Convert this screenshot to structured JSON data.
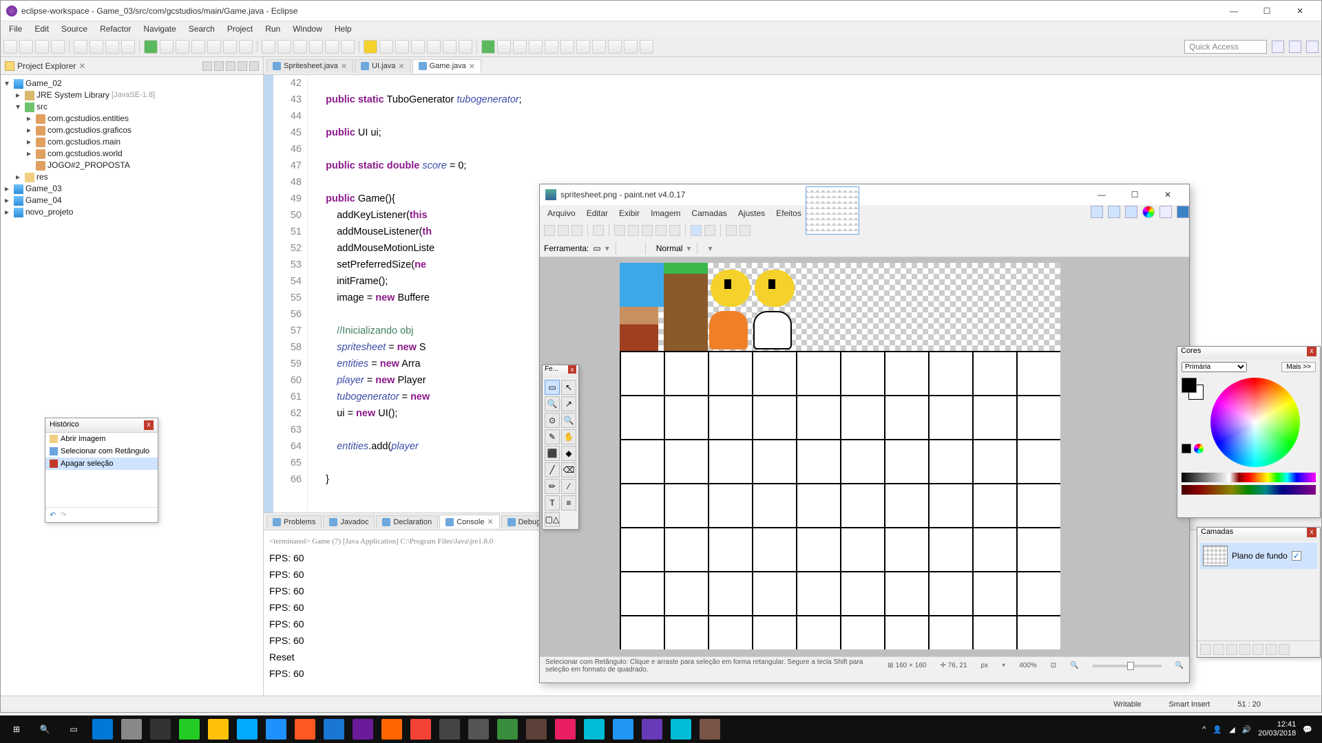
{
  "eclipse": {
    "title": "eclipse-workspace - Game_03/src/com/gcstudios/main/Game.java - Eclipse",
    "menus": [
      "File",
      "Edit",
      "Source",
      "Refactor",
      "Navigate",
      "Search",
      "Project",
      "Run",
      "Window",
      "Help"
    ],
    "quick_access": "Quick Access",
    "project_explorer": {
      "title": "Project Explorer",
      "tree": [
        {
          "indent": 0,
          "arrow": "▾",
          "icon": "proj",
          "label": "Game_02"
        },
        {
          "indent": 1,
          "arrow": "▸",
          "icon": "lib",
          "label": "JRE System Library",
          "note": "[JavaSE-1.8]"
        },
        {
          "indent": 1,
          "arrow": "▾",
          "icon": "src",
          "label": "src"
        },
        {
          "indent": 2,
          "arrow": "▸",
          "icon": "pkg",
          "label": "com.gcstudios.entities"
        },
        {
          "indent": 2,
          "arrow": "▸",
          "icon": "pkg",
          "label": "com.gcstudios.graficos"
        },
        {
          "indent": 2,
          "arrow": "▸",
          "icon": "pkg",
          "label": "com.gcstudios.main"
        },
        {
          "indent": 2,
          "arrow": "▸",
          "icon": "pkg",
          "label": "com.gcstudios.world"
        },
        {
          "indent": 2,
          "arrow": "",
          "icon": "pkg",
          "label": "JOGO#2_PROPOSTA"
        },
        {
          "indent": 1,
          "arrow": "▸",
          "icon": "fold",
          "label": "res"
        },
        {
          "indent": 0,
          "arrow": "▸",
          "icon": "proj",
          "label": "Game_03"
        },
        {
          "indent": 0,
          "arrow": "▸",
          "icon": "proj",
          "label": "Game_04"
        },
        {
          "indent": 0,
          "arrow": "▸",
          "icon": "proj",
          "label": "novo_projeto"
        }
      ]
    },
    "tabs": [
      {
        "label": "Spritesheet.java",
        "active": false
      },
      {
        "label": "UI.java",
        "active": false
      },
      {
        "label": "Game.java",
        "active": true
      }
    ],
    "code_lines": [
      {
        "n": 42,
        "html": ""
      },
      {
        "n": 43,
        "html": "    <span class='kw'>public</span> <span class='kw'>static</span> TuboGenerator <span class='fld'>tubogenerator</span>;"
      },
      {
        "n": 44,
        "html": ""
      },
      {
        "n": 45,
        "html": "    <span class='kw'>public</span> UI ui;"
      },
      {
        "n": 46,
        "html": ""
      },
      {
        "n": 47,
        "html": "    <span class='kw'>public</span> <span class='kw'>static</span> <span class='kw'>double</span> <span class='fld'>score</span> = 0;"
      },
      {
        "n": 48,
        "html": ""
      },
      {
        "n": 49,
        "html": "    <span class='kw'>public</span> Game(){"
      },
      {
        "n": 50,
        "html": "        addKeyListener(<span class='kw'>this</span>"
      },
      {
        "n": 51,
        "html": "        addMouseListener(<span class='kw'>th</span>"
      },
      {
        "n": 52,
        "html": "        addMouseMotionListe"
      },
      {
        "n": 53,
        "html": "        setPreferredSize(<span class='kw'>ne</span>"
      },
      {
        "n": 54,
        "html": "        initFrame();"
      },
      {
        "n": 55,
        "html": "        image = <span class='kw'>new</span> Buffere"
      },
      {
        "n": 56,
        "html": ""
      },
      {
        "n": 57,
        "html": "        <span class='com'>//Inicializando obj</span>"
      },
      {
        "n": 58,
        "html": "        <span class='fld'>spritesheet</span> = <span class='kw'>new</span> S"
      },
      {
        "n": 59,
        "html": "        <span class='fld'>entities</span> = <span class='kw'>new</span> Arra"
      },
      {
        "n": 60,
        "html": "        <span class='fld'>player</span> = <span class='kw'>new</span> Player"
      },
      {
        "n": 61,
        "html": "        <span class='fld'>tubogenerator</span> = <span class='kw'>new</span>"
      },
      {
        "n": 62,
        "html": "        ui = <span class='kw'>new</span> UI();"
      },
      {
        "n": 63,
        "html": ""
      },
      {
        "n": 64,
        "html": "        <span class='fld'>entities</span>.add(<span class='fld'>player</span>"
      },
      {
        "n": 65,
        "html": ""
      },
      {
        "n": 66,
        "html": "    }"
      }
    ],
    "bottom_tabs": [
      "Problems",
      "Javadoc",
      "Declaration",
      "Console",
      "Debug"
    ],
    "active_bottom_tab": 3,
    "console_header": "<terminated> Game (7) [Java Application] C:\\Program Files\\Java\\jre1.8.0",
    "console": [
      "FPS: 60",
      "FPS: 60",
      "FPS: 60",
      "FPS: 60",
      "FPS: 60",
      "FPS: 60",
      "Reset",
      "FPS: 60"
    ],
    "status": {
      "writable": "Writable",
      "insert": "Smart Insert",
      "pos": "51 : 20"
    }
  },
  "history": {
    "title": "Histórico",
    "items": [
      {
        "icon": "#f0d080",
        "label": "Abrir imagem",
        "sel": false
      },
      {
        "icon": "#6aa5e0",
        "label": "Selecionar com Retângulo",
        "sel": false
      },
      {
        "icon": "#c0392b",
        "label": "Apagar seleção",
        "sel": true
      }
    ]
  },
  "pdn": {
    "title": "spritesheet.png - paint.net v4.0.17",
    "menus": [
      "Arquivo",
      "Editar",
      "Exibir",
      "Imagem",
      "Camadas",
      "Ajustes",
      "Efeitos"
    ],
    "ferramenta_label": "Ferramenta:",
    "normal_label": "Normal",
    "status_hint": "Selecionar com Retângulo: Clique e arraste para seleção em forma retangular. Segure a tecla Shift para seleção em formato de quadrado.",
    "canvas_size": "160 × 160",
    "cursor_pos": "76, 21",
    "unit": "px",
    "zoom": "400%",
    "tools": [
      "▭",
      "↖",
      "🔍",
      "↗",
      "⊙",
      "🔍",
      "✎",
      "✋",
      "⬛",
      "◆",
      "╱",
      "⌫",
      "✏",
      "⁄",
      "T",
      "≡",
      "▢△"
    ],
    "tools_title": "Fe...",
    "colors": {
      "title": "Cores",
      "select": "Primária",
      "more": "Mais >>"
    },
    "layers": {
      "title": "Camadas",
      "layer_name": "Plano de fundo"
    }
  },
  "taskbar": {
    "time": "12:41",
    "date": "20/03/2018",
    "icons": [
      "#0078d7",
      "#888",
      "#333",
      "#2c2",
      "#ffc107",
      "#0af",
      "#1e90ff",
      "#ff5722",
      "#1976d2",
      "#6a1b9a",
      "#ff6600",
      "#f44336",
      "#444",
      "#555",
      "#388e3c",
      "#5d4037",
      "#e91e63",
      "#00bcd4",
      "#2196f3",
      "#673ab7",
      "#00bcd4",
      "#795548"
    ]
  }
}
